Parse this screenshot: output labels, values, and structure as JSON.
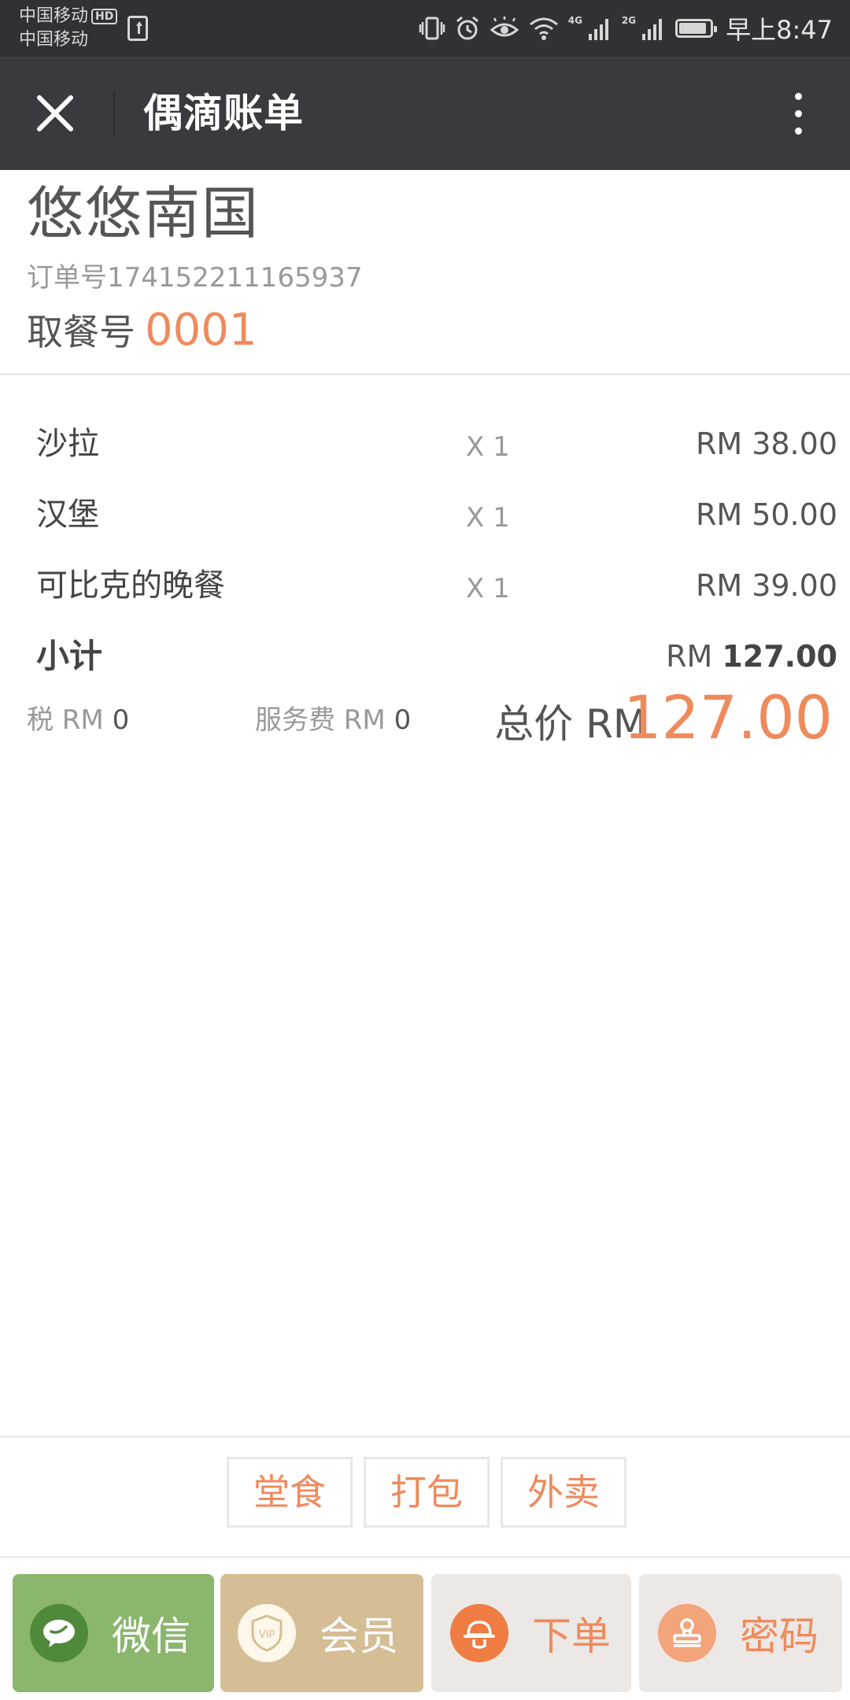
{
  "status_bar": {
    "carrier_1": "中国移动",
    "carrier_1_badge": "HD",
    "carrier_2": "中国移动",
    "network_1": "4G",
    "network_2": "2G",
    "battery_level": 0.9,
    "time": "早上8:47"
  },
  "title_bar": {
    "title": "偶滴账单"
  },
  "bill": {
    "shop_name": "悠悠南国",
    "order_no": "订单号174152211165937",
    "pickup_label": "取餐号",
    "pickup_number": "0001",
    "items": [
      {
        "name": "沙拉",
        "qty": "X 1",
        "price": "RM 38.00"
      },
      {
        "name": "汉堡",
        "qty": "X 1",
        "price": "RM 50.00"
      },
      {
        "name": "可比克的晚餐",
        "qty": "X 1",
        "price": "RM 39.00"
      }
    ],
    "subtotal_label": "小计",
    "subtotal_currency": "RM",
    "subtotal_value": "127.00",
    "tax_label": "税 RM",
    "tax_value": "0",
    "service_label": "服务费 RM",
    "service_value": "0",
    "total_label": "总价 RM",
    "total_value": "127.00"
  },
  "dining_options": {
    "dine_in": "堂食",
    "takeaway": "打包",
    "delivery": "外卖"
  },
  "actions": {
    "wechat": "微信",
    "member": "会员",
    "member_badge": "VIP",
    "order": "下单",
    "password": "密码"
  },
  "colors": {
    "accent": "#ef8a5c",
    "title_bar": "#393a3f",
    "status_bar": "#2f3134",
    "wechat_green": "#8ab66e",
    "member_gold": "#d5be95"
  },
  "icons": {
    "close": "close-icon",
    "more": "more-vertical-icon",
    "wechat": "wechat-icon",
    "member": "vip-shield-icon",
    "order": "chef-hat-icon",
    "password": "stamp-icon"
  }
}
